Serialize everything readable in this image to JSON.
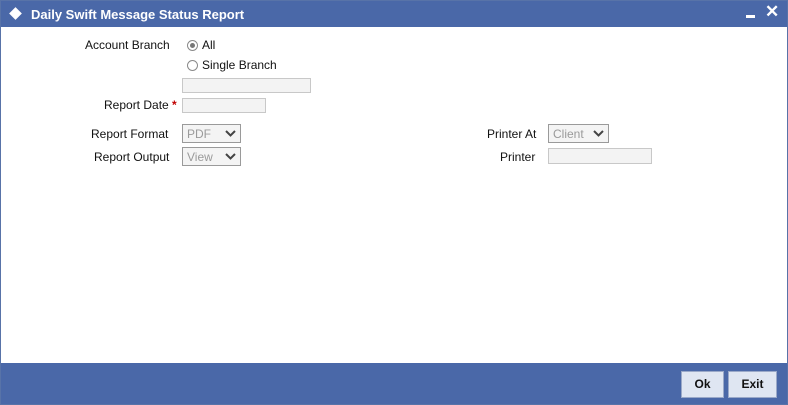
{
  "window": {
    "title": "Daily Swift Message Status Report"
  },
  "form": {
    "account_branch_label": "Account Branch",
    "radio_all_label": "All",
    "radio_single_label": "Single Branch",
    "branch_value": "",
    "report_date_label": "Report Date",
    "required_mark": "*",
    "report_date_value": "",
    "report_format_label": "Report Format",
    "report_format_value": "PDF",
    "report_output_label": "Report Output",
    "report_output_value": "View",
    "printer_at_label": "Printer At",
    "printer_at_value": "Client",
    "printer_label": "Printer",
    "printer_value": ""
  },
  "buttons": {
    "ok": "Ok",
    "exit": "Exit"
  }
}
